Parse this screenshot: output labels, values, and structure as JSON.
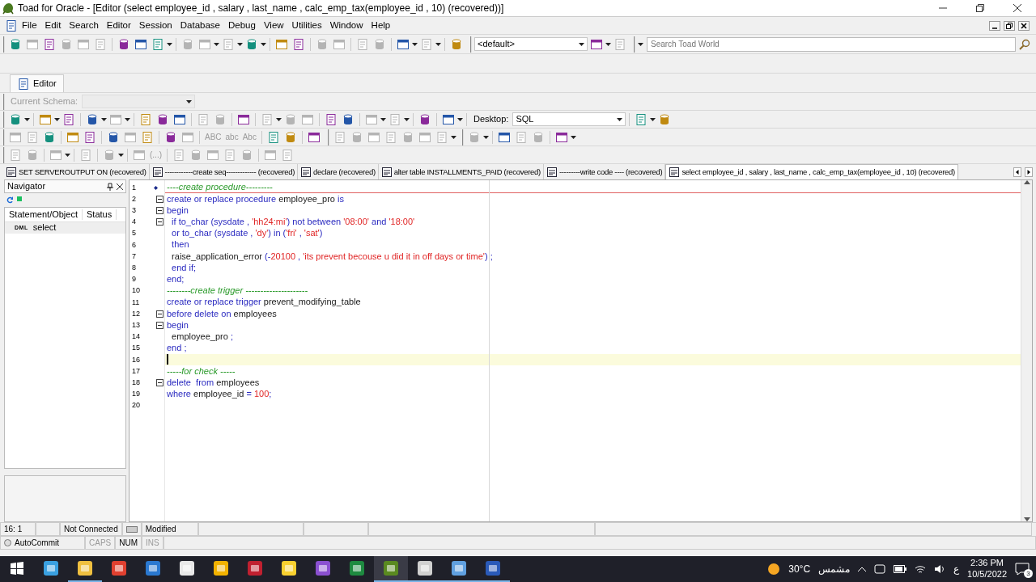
{
  "window": {
    "title": "Toad for Oracle - [Editor (select employee_id , salary , last_name , calc_emp_tax(employee_id , 10) (recovered))]"
  },
  "menu": [
    "File",
    "Edit",
    "Search",
    "Editor",
    "Session",
    "Database",
    "Debug",
    "View",
    "Utilities",
    "Window",
    "Help"
  ],
  "toolbar_rows": [
    {
      "groups": [
        [
          {
            "kind": "icon",
            "disabled": false,
            "caret": false
          },
          {
            "kind": "icon",
            "disabled": true,
            "caret": false
          },
          {
            "kind": "icon",
            "disabled": false,
            "caret": false
          },
          {
            "kind": "icon",
            "disabled": true,
            "caret": false
          },
          {
            "kind": "icon",
            "disabled": true,
            "caret": false
          },
          {
            "kind": "icon",
            "disabled": true,
            "caret": false
          },
          {
            "kind": "sep"
          },
          {
            "kind": "icon",
            "disabled": false,
            "caret": false
          },
          {
            "kind": "icon",
            "disabled": false,
            "caret": false
          },
          {
            "kind": "icon",
            "disabled": false,
            "caret": true
          },
          {
            "kind": "sep"
          },
          {
            "kind": "icon",
            "disabled": true,
            "caret": false
          },
          {
            "kind": "icon",
            "disabled": true,
            "caret": true
          },
          {
            "kind": "icon",
            "disabled": true,
            "caret": true
          },
          {
            "kind": "icon",
            "disabled": false,
            "caret": true
          },
          {
            "kind": "sep"
          },
          {
            "kind": "icon",
            "disabled": false,
            "caret": false
          },
          {
            "kind": "icon",
            "disabled": false,
            "caret": false
          },
          {
            "kind": "sep"
          },
          {
            "kind": "icon",
            "disabled": true,
            "caret": false
          },
          {
            "kind": "icon",
            "disabled": true,
            "caret": false
          },
          {
            "kind": "sep"
          },
          {
            "kind": "icon",
            "disabled": true,
            "caret": false
          },
          {
            "kind": "icon",
            "disabled": true,
            "caret": false
          },
          {
            "kind": "sep"
          },
          {
            "kind": "icon",
            "disabled": false,
            "caret": true
          },
          {
            "kind": "icon",
            "disabled": true,
            "caret": true
          },
          {
            "kind": "sep"
          },
          {
            "kind": "icon",
            "disabled": false,
            "caret": false
          }
        ],
        [
          {
            "kind": "select",
            "value": "<default>",
            "disabled": false
          },
          {
            "kind": "icon",
            "disabled": false,
            "caret": true
          },
          {
            "kind": "icon",
            "disabled": true,
            "caret": false
          }
        ],
        [
          {
            "kind": "search",
            "placeholder": "Search Toad World"
          }
        ]
      ]
    },
    {
      "groups": []
    },
    {
      "groups": [
        [
          {
            "kind": "label",
            "text": "Current Schema:",
            "disabled": true
          },
          {
            "kind": "select",
            "disabled": true
          }
        ]
      ]
    },
    {
      "groups": [
        [
          {
            "kind": "icon",
            "disabled": false,
            "caret": true
          },
          {
            "kind": "sep"
          },
          {
            "kind": "icon",
            "disabled": false,
            "caret": true
          },
          {
            "kind": "icon",
            "disabled": false,
            "caret": false
          },
          {
            "kind": "sep"
          },
          {
            "kind": "icon",
            "disabled": false,
            "caret": true
          },
          {
            "kind": "icon",
            "disabled": true,
            "caret": true
          },
          {
            "kind": "sep"
          },
          {
            "kind": "icon",
            "disabled": false,
            "caret": false
          },
          {
            "kind": "icon",
            "disabled": false,
            "caret": false
          },
          {
            "kind": "icon",
            "disabled": false,
            "caret": false
          },
          {
            "kind": "sep"
          },
          {
            "kind": "icon",
            "disabled": true,
            "caret": false
          },
          {
            "kind": "icon",
            "disabled": true,
            "caret": false
          },
          {
            "kind": "sep"
          },
          {
            "kind": "icon",
            "disabled": false,
            "caret": false
          },
          {
            "kind": "sep"
          },
          {
            "kind": "icon",
            "disabled": true,
            "caret": true
          },
          {
            "kind": "icon",
            "disabled": true,
            "caret": false
          },
          {
            "kind": "icon",
            "disabled": true,
            "caret": false
          },
          {
            "kind": "sep"
          },
          {
            "kind": "icon",
            "disabled": false,
            "caret": false
          },
          {
            "kind": "icon",
            "disabled": false,
            "caret": false
          },
          {
            "kind": "sep"
          },
          {
            "kind": "icon",
            "disabled": true,
            "caret": true
          },
          {
            "kind": "icon",
            "disabled": true,
            "caret": true
          },
          {
            "kind": "sep"
          },
          {
            "kind": "icon",
            "disabled": false,
            "caret": false
          },
          {
            "kind": "sep"
          },
          {
            "kind": "icon",
            "disabled": false,
            "caret": true
          },
          {
            "kind": "sep"
          },
          {
            "kind": "label",
            "text": "Desktop:",
            "disabled": false
          },
          {
            "kind": "select",
            "value": "SQL",
            "disabled": false
          },
          {
            "kind": "sep"
          },
          {
            "kind": "icon",
            "disabled": false,
            "caret": true
          },
          {
            "kind": "icon",
            "disabled": false,
            "caret": false
          }
        ]
      ]
    },
    {
      "groups": [
        [
          {
            "kind": "icon",
            "disabled": true,
            "caret": false
          },
          {
            "kind": "icon",
            "disabled": true,
            "caret": false
          },
          {
            "kind": "icon",
            "disabled": false,
            "caret": false
          },
          {
            "kind": "sep"
          },
          {
            "kind": "icon",
            "disabled": false,
            "caret": false
          },
          {
            "kind": "icon",
            "disabled": false,
            "caret": false
          },
          {
            "kind": "sep"
          },
          {
            "kind": "icon",
            "disabled": false,
            "caret": false
          },
          {
            "kind": "icon",
            "disabled": true,
            "caret": false
          },
          {
            "kind": "icon",
            "disabled": false,
            "caret": false
          },
          {
            "kind": "sep"
          },
          {
            "kind": "icon",
            "disabled": false,
            "caret": false
          },
          {
            "kind": "icon",
            "disabled": true,
            "caret": false
          },
          {
            "kind": "sep"
          },
          {
            "kind": "text",
            "text": "ABC",
            "disabled": true
          },
          {
            "kind": "text",
            "text": "abc",
            "disabled": true
          },
          {
            "kind": "text",
            "text": "Abc",
            "disabled": true
          },
          {
            "kind": "sep"
          },
          {
            "kind": "icon",
            "disabled": false,
            "caret": false
          },
          {
            "kind": "icon",
            "disabled": false,
            "caret": false
          },
          {
            "kind": "sep"
          },
          {
            "kind": "icon",
            "disabled": false,
            "caret": false
          }
        ],
        [
          {
            "kind": "icon",
            "disabled": true,
            "caret": false
          },
          {
            "kind": "icon",
            "disabled": true,
            "caret": false
          },
          {
            "kind": "icon",
            "disabled": true,
            "caret": false
          },
          {
            "kind": "icon",
            "disabled": true,
            "caret": false
          },
          {
            "kind": "icon",
            "disabled": true,
            "caret": false
          },
          {
            "kind": "icon",
            "disabled": true,
            "caret": false
          },
          {
            "kind": "icon",
            "disabled": true,
            "caret": true
          }
        ],
        [
          {
            "kind": "icon",
            "disabled": true,
            "caret": true
          },
          {
            "kind": "sep"
          },
          {
            "kind": "icon",
            "disabled": false,
            "caret": false
          },
          {
            "kind": "icon",
            "disabled": true,
            "caret": false
          },
          {
            "kind": "icon",
            "disabled": true,
            "caret": false
          },
          {
            "kind": "sep"
          },
          {
            "kind": "icon",
            "disabled": false,
            "caret": true
          }
        ]
      ]
    },
    {
      "groups": [
        [
          {
            "kind": "icon",
            "disabled": true,
            "caret": false
          },
          {
            "kind": "icon",
            "disabled": true,
            "caret": false
          },
          {
            "kind": "sep"
          },
          {
            "kind": "icon",
            "disabled": true,
            "caret": true
          },
          {
            "kind": "sep"
          },
          {
            "kind": "icon",
            "disabled": true,
            "caret": false
          },
          {
            "kind": "sep"
          },
          {
            "kind": "icon",
            "disabled": true,
            "caret": true
          },
          {
            "kind": "sep"
          },
          {
            "kind": "icon",
            "disabled": true,
            "caret": false
          },
          {
            "kind": "text",
            "text": "(...)",
            "disabled": true
          },
          {
            "kind": "sep"
          },
          {
            "kind": "icon",
            "disabled": true,
            "caret": false
          },
          {
            "kind": "icon",
            "disabled": true,
            "caret": false
          },
          {
            "kind": "icon",
            "disabled": true,
            "caret": false
          },
          {
            "kind": "icon",
            "disabled": true,
            "caret": false
          },
          {
            "kind": "icon",
            "disabled": true,
            "caret": false
          },
          {
            "kind": "sep"
          },
          {
            "kind": "icon",
            "disabled": true,
            "caret": false
          },
          {
            "kind": "icon",
            "disabled": true,
            "caret": false
          }
        ]
      ]
    }
  ],
  "window_tab": {
    "label": "Editor"
  },
  "tabs": [
    {
      "label": "SET SERVEROUTPUT ON (recovered)",
      "selected": false
    },
    {
      "label": "------------create seq------------- (recovered)",
      "selected": false
    },
    {
      "label": "declare (recovered)",
      "selected": false
    },
    {
      "label": "alter table INSTALLMENTS_PAID (recovered)",
      "selected": false
    },
    {
      "label": "---------write code ---- (recovered)",
      "selected": false
    },
    {
      "label": "select employee_id , salary , last_name , calc_emp_tax(employee_id , 10) (recovered)",
      "selected": true
    }
  ],
  "navigator": {
    "title": "Navigator",
    "columns": [
      "Statement/Object",
      "Status"
    ],
    "rows": [
      {
        "tag": "DML",
        "object": "select"
      }
    ]
  },
  "editor": {
    "lines": [
      {
        "number": "1",
        "bookmark": true,
        "fold": false,
        "current": false,
        "tokens": [
          {
            "kind": "comment",
            "t": "----create procedure---------"
          }
        ]
      },
      {
        "number": "2",
        "bookmark": false,
        "fold": true,
        "current": false,
        "tokens": [
          {
            "kind": "keyword",
            "t": "create or replace procedure"
          },
          {
            "kind": "identifier",
            "t": " employee_pro "
          },
          {
            "kind": "keyword",
            "t": "is"
          }
        ]
      },
      {
        "number": "3",
        "bookmark": false,
        "fold": true,
        "current": false,
        "tokens": [
          {
            "kind": "keyword",
            "t": "begin"
          }
        ]
      },
      {
        "number": "4",
        "bookmark": false,
        "fold": true,
        "current": false,
        "tokens": [
          {
            "kind": "keyword",
            "t": "  if to_char (sysdate , "
          },
          {
            "kind": "string",
            "t": "'hh24:mi'"
          },
          {
            "kind": "keyword",
            "t": ") not between "
          },
          {
            "kind": "string",
            "t": "'08:00'"
          },
          {
            "kind": "keyword",
            "t": " and "
          },
          {
            "kind": "string",
            "t": "'18:00'"
          }
        ]
      },
      {
        "number": "5",
        "bookmark": false,
        "fold": false,
        "current": false,
        "tokens": [
          {
            "kind": "keyword",
            "t": "  or to_char (sysdate , "
          },
          {
            "kind": "string",
            "t": "'dy'"
          },
          {
            "kind": "keyword",
            "t": ") in ("
          },
          {
            "kind": "string",
            "t": "'fri'"
          },
          {
            "kind": "keyword",
            "t": " , "
          },
          {
            "kind": "string",
            "t": "'sat'"
          },
          {
            "kind": "keyword",
            "t": ")"
          }
        ]
      },
      {
        "number": "6",
        "bookmark": false,
        "fold": false,
        "current": false,
        "tokens": [
          {
            "kind": "keyword",
            "t": "  then"
          }
        ]
      },
      {
        "number": "7",
        "bookmark": false,
        "fold": false,
        "current": false,
        "tokens": [
          {
            "kind": "identifier",
            "t": "  raise_application_error "
          },
          {
            "kind": "keyword",
            "t": "(-"
          },
          {
            "kind": "string",
            "t": "20100"
          },
          {
            "kind": "keyword",
            "t": " , "
          },
          {
            "kind": "string",
            "t": "'its prevent becouse u did it in off days or time'"
          },
          {
            "kind": "keyword",
            "t": ") ;"
          }
        ]
      },
      {
        "number": "8",
        "bookmark": false,
        "fold": false,
        "current": false,
        "tokens": [
          {
            "kind": "keyword",
            "t": "  end if;"
          }
        ]
      },
      {
        "number": "9",
        "bookmark": false,
        "fold": false,
        "current": false,
        "tokens": [
          {
            "kind": "keyword",
            "t": "end;"
          }
        ]
      },
      {
        "number": "10",
        "bookmark": false,
        "fold": false,
        "current": false,
        "tokens": [
          {
            "kind": "comment",
            "t": "--------create trigger ---------------------"
          }
        ]
      },
      {
        "number": "11",
        "bookmark": false,
        "fold": false,
        "current": false,
        "tokens": [
          {
            "kind": "keyword",
            "t": "create or replace trigger"
          },
          {
            "kind": "identifier",
            "t": " prevent_modifying_table"
          }
        ]
      },
      {
        "number": "12",
        "bookmark": false,
        "fold": true,
        "current": false,
        "tokens": [
          {
            "kind": "keyword",
            "t": "before delete on"
          },
          {
            "kind": "identifier",
            "t": " employees"
          }
        ]
      },
      {
        "number": "13",
        "bookmark": false,
        "fold": true,
        "current": false,
        "tokens": [
          {
            "kind": "keyword",
            "t": "begin"
          }
        ]
      },
      {
        "number": "14",
        "bookmark": false,
        "fold": false,
        "current": false,
        "tokens": [
          {
            "kind": "identifier",
            "t": "  employee_pro "
          },
          {
            "kind": "keyword",
            "t": ";"
          }
        ]
      },
      {
        "number": "15",
        "bookmark": false,
        "fold": false,
        "current": false,
        "tokens": [
          {
            "kind": "keyword",
            "t": "end ;"
          }
        ]
      },
      {
        "number": "16",
        "bookmark": false,
        "fold": false,
        "current": true
      },
      {
        "number": "17",
        "bookmark": false,
        "fold": false,
        "current": false,
        "tokens": [
          {
            "kind": "comment",
            "t": "-----for check -----"
          }
        ]
      },
      {
        "number": "18",
        "bookmark": false,
        "fold": true,
        "current": false,
        "tokens": [
          {
            "kind": "keyword",
            "t": "delete  from"
          },
          {
            "kind": "identifier",
            "t": " employees"
          }
        ]
      },
      {
        "number": "19",
        "bookmark": false,
        "fold": false,
        "current": false,
        "tokens": [
          {
            "kind": "keyword",
            "t": "where"
          },
          {
            "kind": "identifier",
            "t": " employee_id "
          },
          {
            "kind": "keyword",
            "t": "= "
          },
          {
            "kind": "string",
            "t": "100"
          },
          {
            "kind": "keyword",
            "t": ";"
          }
        ]
      },
      {
        "number": "20",
        "bookmark": false,
        "fold": false,
        "current": false
      }
    ]
  },
  "status_bar": {
    "position": "16:  1",
    "connection": "Not Connected",
    "state": "Modified",
    "autocommit": "AutoCommit",
    "keys": [
      {
        "label": "CAPS",
        "on": false
      },
      {
        "label": "NUM",
        "on": true
      },
      {
        "label": "INS",
        "on": false
      }
    ]
  },
  "taskbar": {
    "apps": [
      {
        "running": false,
        "selected": false
      },
      {
        "running": true,
        "selected": false
      },
      {
        "running": false,
        "selected": false
      },
      {
        "running": false,
        "selected": false
      },
      {
        "running": false,
        "selected": false
      },
      {
        "running": false,
        "selected": false
      },
      {
        "running": false,
        "selected": false
      },
      {
        "running": false,
        "selected": false
      },
      {
        "running": false,
        "selected": false
      },
      {
        "running": false,
        "selected": false
      },
      {
        "running": true,
        "selected": true
      },
      {
        "running": true,
        "selected": false
      },
      {
        "running": true,
        "selected": false
      },
      {
        "running": true,
        "selected": false
      }
    ],
    "temperature": "30°C",
    "weather": "مشمس",
    "language": "ع",
    "time": "2:36 PM",
    "date": "10/5/2022",
    "notifications": "3"
  }
}
